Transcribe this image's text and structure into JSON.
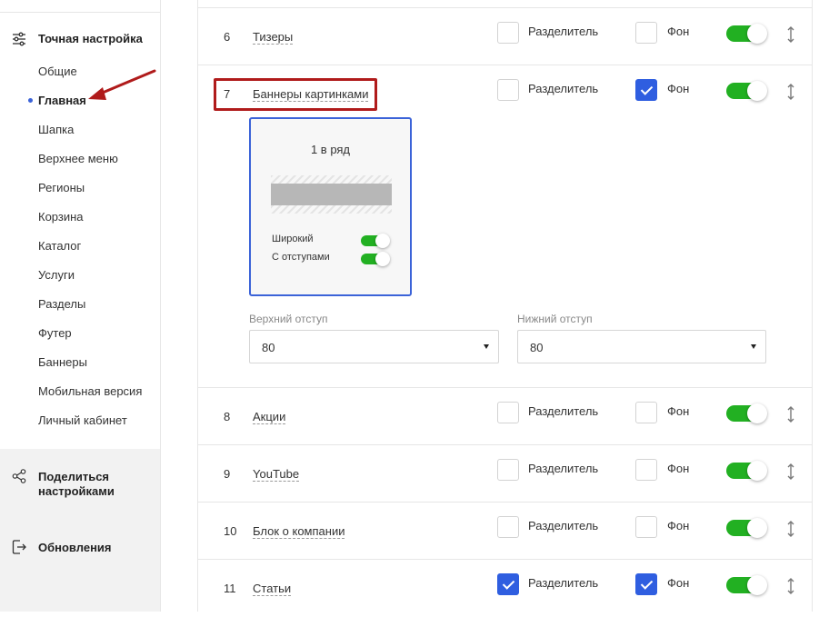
{
  "sidebar": {
    "fine_tuning_title": "Точная настройка",
    "items": [
      {
        "label": "Общие"
      },
      {
        "label": "Главная",
        "active": true
      },
      {
        "label": "Шапка"
      },
      {
        "label": "Верхнее меню"
      },
      {
        "label": "Регионы"
      },
      {
        "label": "Корзина"
      },
      {
        "label": "Каталог"
      },
      {
        "label": "Услуги"
      },
      {
        "label": "Разделы"
      },
      {
        "label": "Футер"
      },
      {
        "label": "Баннеры"
      },
      {
        "label": "Мобильная версия"
      },
      {
        "label": "Личный кабинет"
      }
    ],
    "share_title": "Поделиться настройками",
    "updates_title": "Обновления"
  },
  "labels": {
    "divider": "Разделитель",
    "background": "Фон"
  },
  "rows": [
    {
      "num": "6",
      "name": "Тизеры",
      "divider": false,
      "background": false,
      "enabled": true
    },
    {
      "num": "7",
      "name": "Баннеры картинками",
      "divider": false,
      "background": true,
      "enabled": true
    },
    {
      "num": "8",
      "name": "Акции",
      "divider": false,
      "background": false,
      "enabled": true
    },
    {
      "num": "9",
      "name": "YouTube",
      "divider": false,
      "background": false,
      "enabled": true
    },
    {
      "num": "10",
      "name": "Блок о компании",
      "divider": false,
      "background": false,
      "enabled": true
    },
    {
      "num": "11",
      "name": "Статьи",
      "divider": true,
      "background": true,
      "enabled": true
    }
  ],
  "layout_card": {
    "title": "1 в ряд",
    "option_wide": "Широкий",
    "option_wide_on": true,
    "option_padding": "С отступами",
    "option_padding_on": true
  },
  "padding": {
    "top_label": "Верхний отступ",
    "top_value": "80",
    "bottom_label": "Нижний отступ",
    "bottom_value": "80"
  },
  "colors": {
    "accent": "#3b63d8",
    "toggle_on": "#22b022",
    "highlight": "#b01b1b"
  }
}
